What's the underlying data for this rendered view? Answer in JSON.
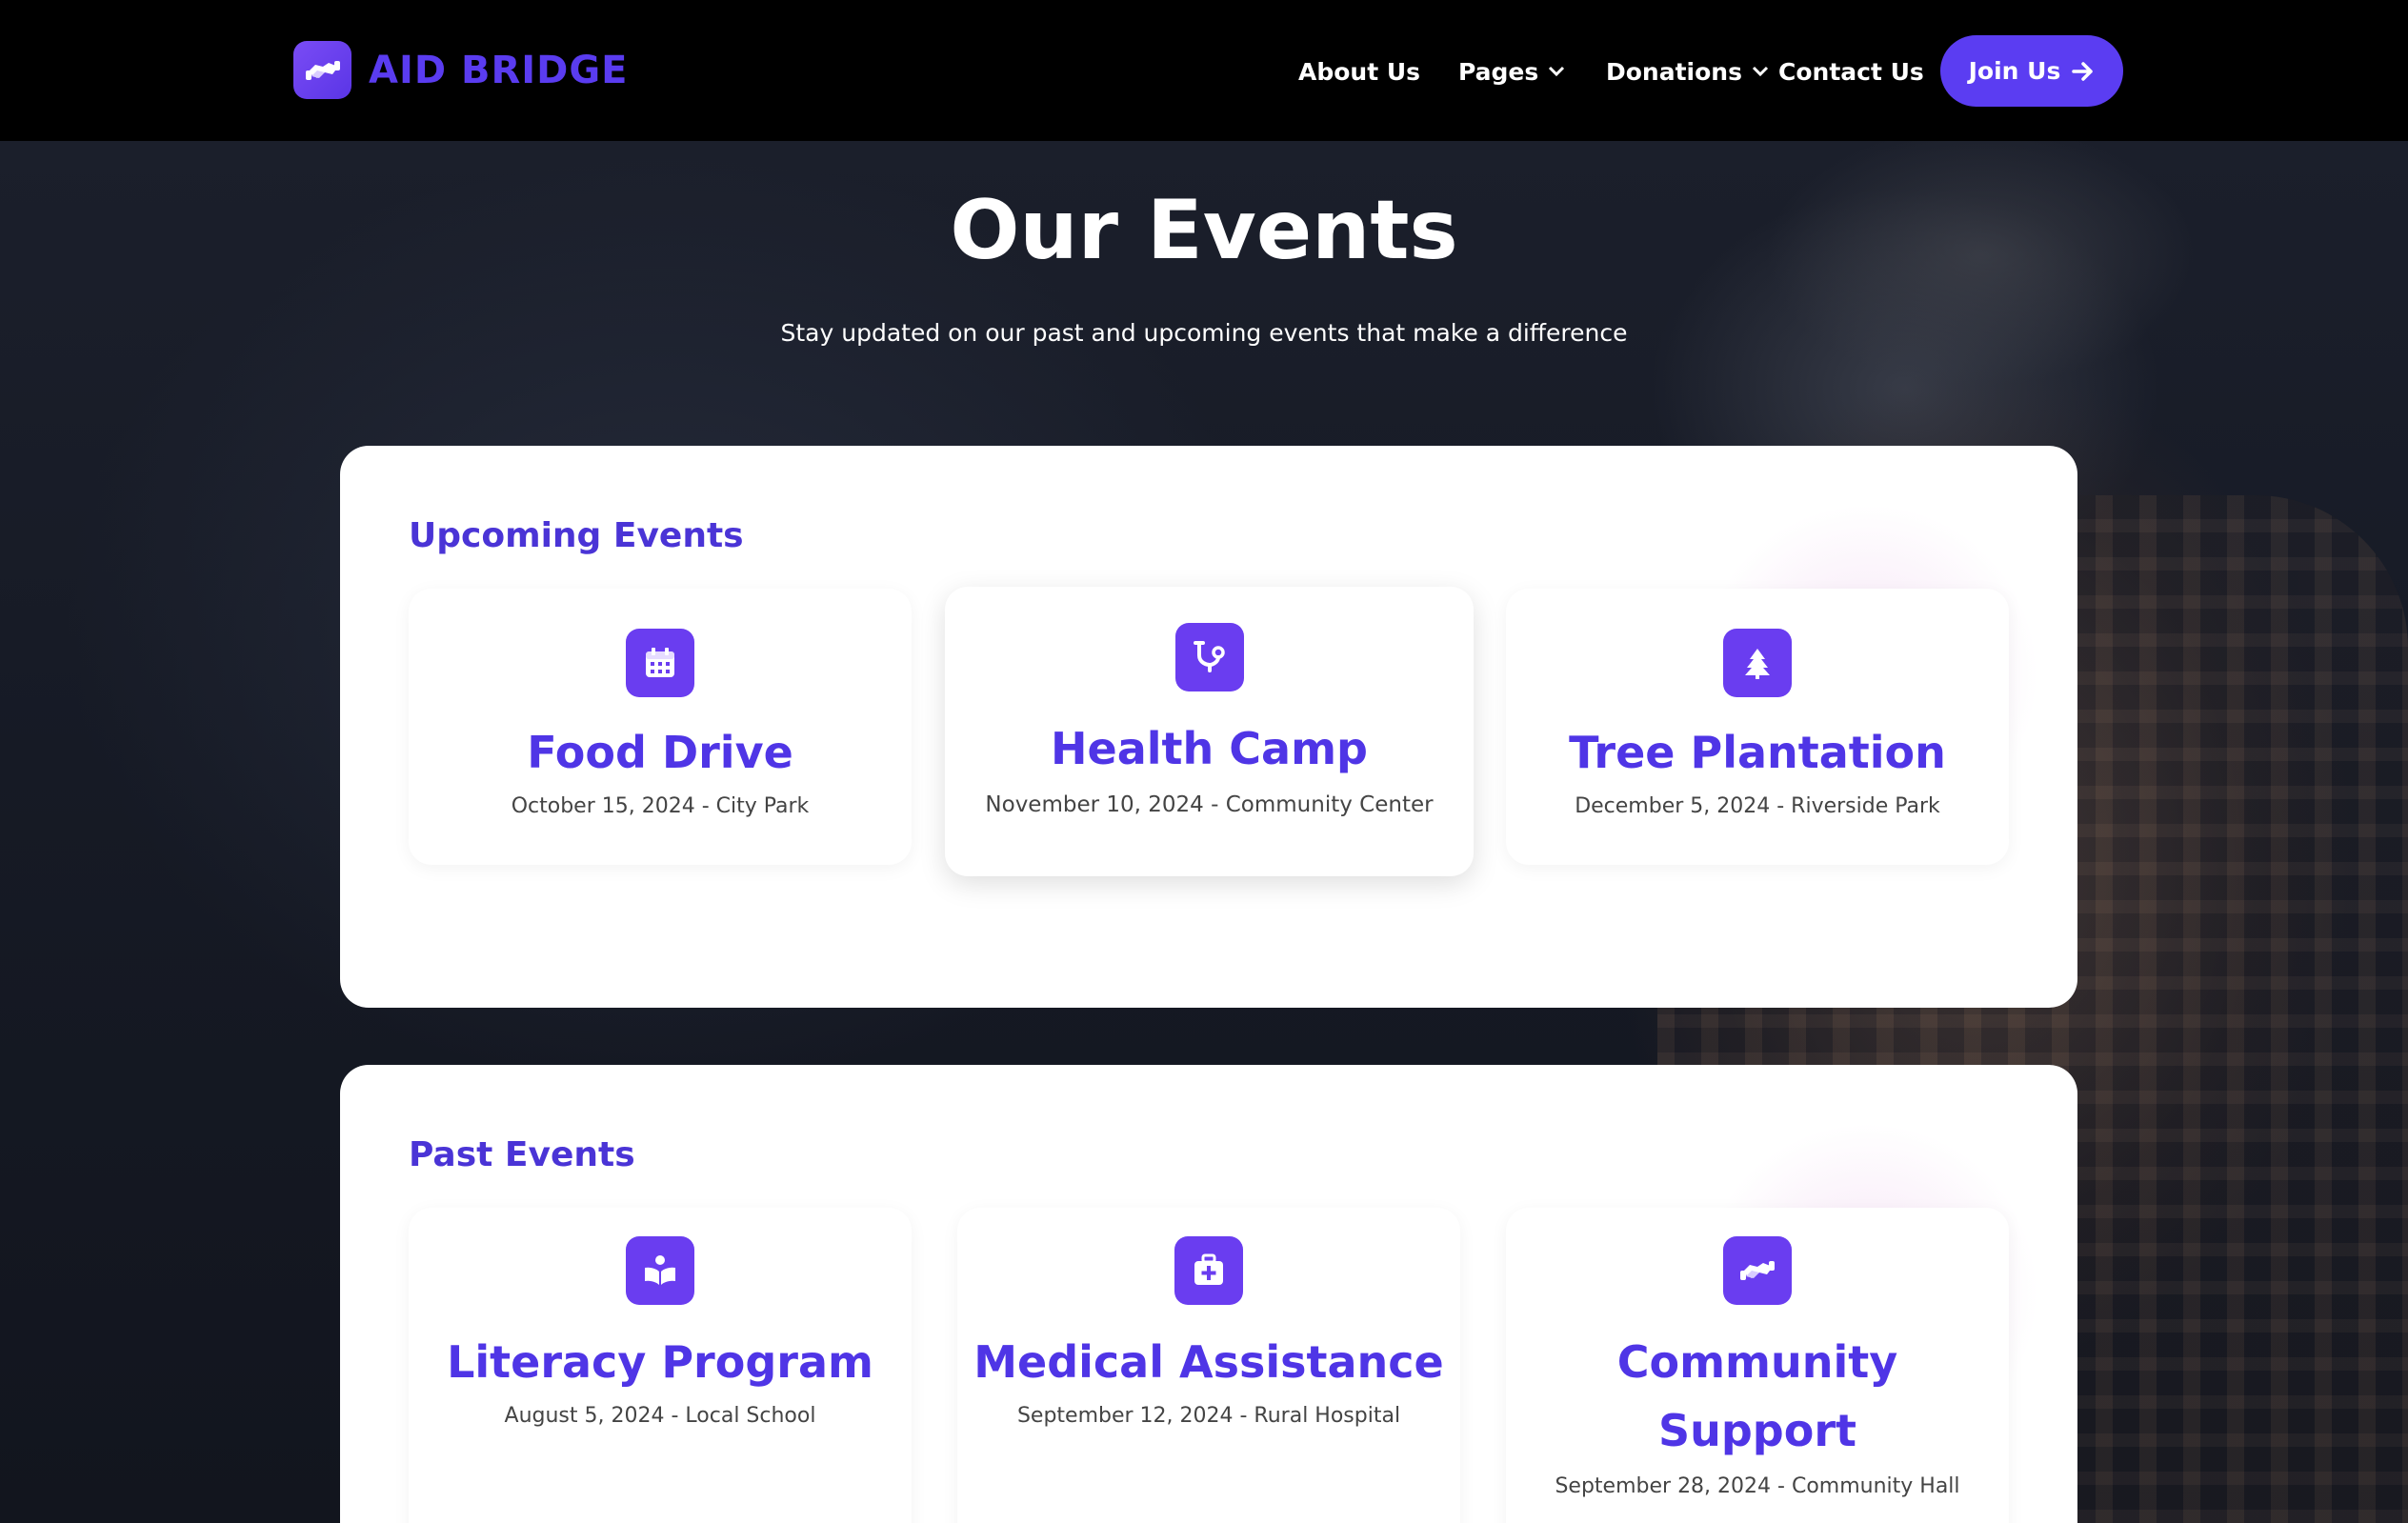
{
  "brand": {
    "name": "AID BRIDGE",
    "icon": "handshake-icon"
  },
  "nav": {
    "items": [
      {
        "label": "About Us",
        "has_dropdown": false
      },
      {
        "label": "Pages",
        "has_dropdown": true
      },
      {
        "label": "Donations",
        "has_dropdown": true
      },
      {
        "label": "Contact Us",
        "has_dropdown": false
      }
    ],
    "cta_label": "Join Us"
  },
  "hero": {
    "title": "Our Events",
    "subtitle": "Stay updated on our past and upcoming events that make a difference"
  },
  "upcoming": {
    "heading": "Upcoming Events",
    "events": [
      {
        "icon": "calendar-icon",
        "title": "Food Drive",
        "meta": "October 15, 2024 - City Park"
      },
      {
        "icon": "stethoscope-icon",
        "title": "Health Camp",
        "meta": "November 10, 2024 - Community Center"
      },
      {
        "icon": "tree-icon",
        "title": "Tree Plantation",
        "meta": "December 5, 2024 - Riverside Park"
      }
    ]
  },
  "past": {
    "heading": "Past Events",
    "events": [
      {
        "icon": "book-reader-icon",
        "title": "Literacy Program",
        "meta": "August 5, 2024 - Local School"
      },
      {
        "icon": "medical-kit-icon",
        "title": "Medical Assistance",
        "meta": "September 12, 2024 - Rural Hospital"
      },
      {
        "icon": "handshake-icon",
        "title": "Community Support",
        "meta": "September 28, 2024 - Community Hall"
      }
    ]
  },
  "colors": {
    "accent": "#5b3df2",
    "heading": "#4a34d6",
    "navbar_bg": "#000000",
    "panel_bg": "#ffffff"
  }
}
